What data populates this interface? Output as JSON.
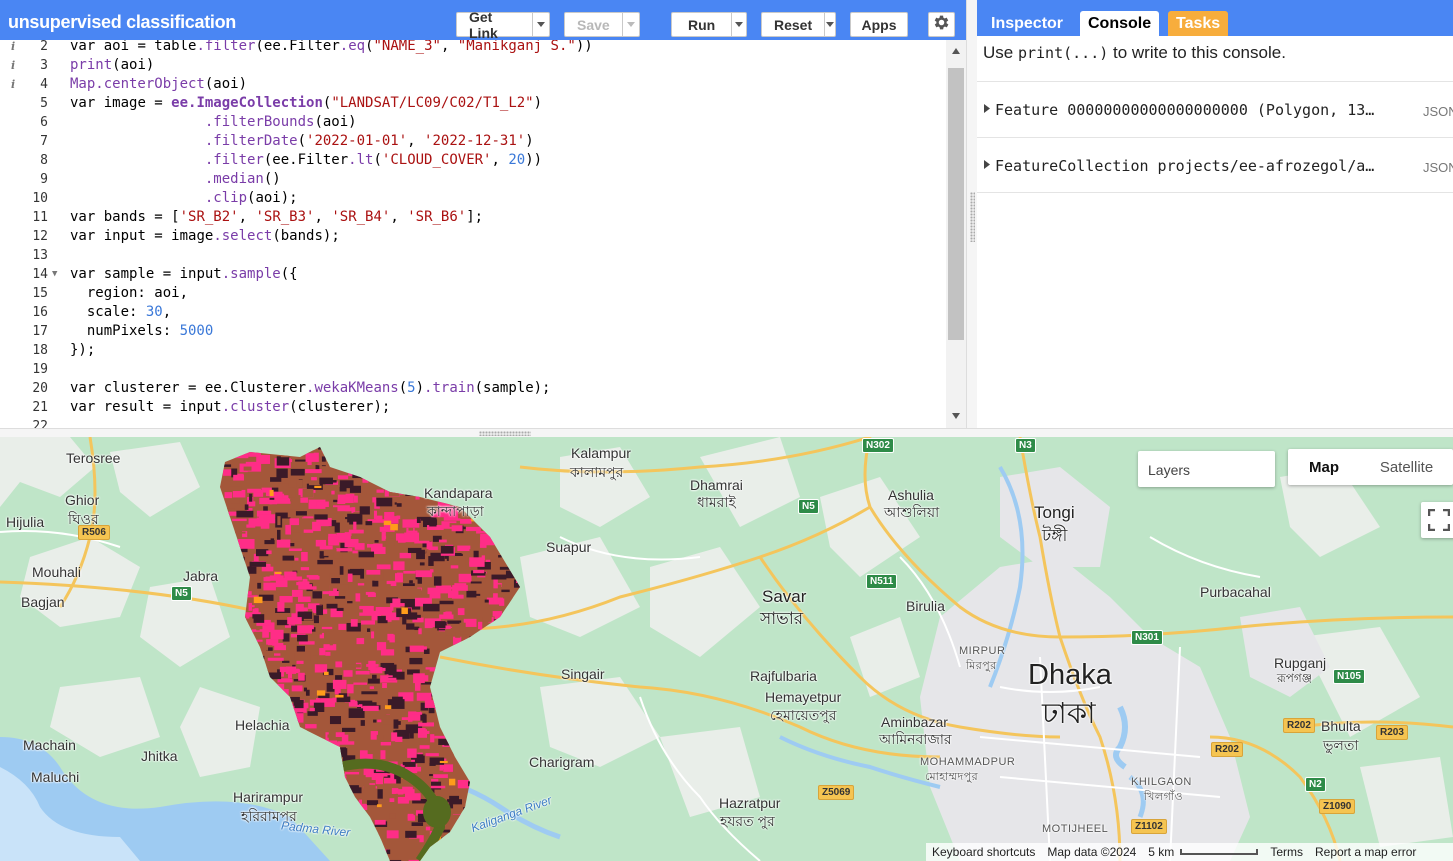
{
  "editor": {
    "script_title": "unsupervised classification",
    "buttons": {
      "get_link": "Get Link",
      "save": "Save",
      "run": "Run",
      "reset": "Reset",
      "apps": "Apps"
    },
    "lines": [
      {
        "num": "2",
        "info": true,
        "html": "var aoi = table.filter(ee.Filter.eq(\"NAME_3\", \"Manikganj S.\"))"
      },
      {
        "num": "3",
        "info": true,
        "html": "print(aoi)"
      },
      {
        "num": "4",
        "info": true,
        "html": "Map.centerObject(aoi)"
      },
      {
        "num": "5",
        "info": false,
        "html": "var image = ee.ImageCollection(\"LANDSAT/LC09/C02/T1_L2\")"
      },
      {
        "num": "6",
        "info": false,
        "html": "                .filterBounds(aoi)"
      },
      {
        "num": "7",
        "info": false,
        "html": "                .filterDate('2022-01-01', '2022-12-31')"
      },
      {
        "num": "8",
        "info": false,
        "html": "                .filter(ee.Filter.lt('CLOUD_COVER', 20))"
      },
      {
        "num": "9",
        "info": false,
        "html": "                .median()"
      },
      {
        "num": "10",
        "info": false,
        "html": "                .clip(aoi);"
      },
      {
        "num": "11",
        "info": false,
        "html": "var bands = ['SR_B2', 'SR_B3', 'SR_B4', 'SR_B6'];"
      },
      {
        "num": "12",
        "info": false,
        "html": "var input = image.select(bands);"
      },
      {
        "num": "13",
        "info": false,
        "html": ""
      },
      {
        "num": "14",
        "info": false,
        "fold": true,
        "html": "var sample = input.sample({"
      },
      {
        "num": "15",
        "info": false,
        "html": "  region: aoi,"
      },
      {
        "num": "16",
        "info": false,
        "html": "  scale: 30,"
      },
      {
        "num": "17",
        "info": false,
        "html": "  numPixels: 5000"
      },
      {
        "num": "18",
        "info": false,
        "html": "});"
      },
      {
        "num": "19",
        "info": false,
        "html": ""
      },
      {
        "num": "20",
        "info": false,
        "html": "var clusterer = ee.Clusterer.wekaKMeans(5).train(sample);"
      },
      {
        "num": "21",
        "info": false,
        "html": "var result = input.cluster(clusterer);"
      },
      {
        "num": "22",
        "info": false,
        "html": ""
      }
    ]
  },
  "right_panel": {
    "tabs": {
      "inspector": "Inspector",
      "console": "Console",
      "tasks": "Tasks"
    },
    "hint_pre": "Use ",
    "hint_code": "print(...)",
    "hint_post": " to write to this console.",
    "rows": [
      {
        "text": "Feature 00000000000000000000 (Polygon, 13…",
        "json": "JSON"
      },
      {
        "text": "FeatureCollection projects/ee-afrozegol/a…",
        "json": "JSON"
      }
    ]
  },
  "map": {
    "layers_label": "Layers",
    "map_type": {
      "map": "Map",
      "satellite": "Satellite"
    },
    "footer": {
      "shortcuts": "Keyboard shortcuts",
      "map_data": "Map data ©2024",
      "scale": "5 km",
      "terms": "Terms",
      "report": "Report a map error"
    },
    "places": {
      "terosree": "Terosree",
      "ghior": "Ghior",
      "ghior_bn": "ঘিওর",
      "hijulia": "Hijulia",
      "mouhali": "Mouhali",
      "bagjan": "Bagjan",
      "jabra": "Jabra",
      "kalampur": "Kalampur",
      "kalampur_bn": "কালামপুর",
      "kandapara": "Kandapara",
      "kandapara_bn": "কান্দাপাড়া",
      "dhamrai": "Dhamrai",
      "dhamrai_bn": "ধামরাই",
      "ashulia": "Ashulia",
      "ashulia_bn": "আশুলিয়া",
      "tongi": "Tongi",
      "tongi_bn": "টঙ্গী",
      "suapur": "Suapur",
      "savar": "Savar",
      "savar_bn": "সাভার",
      "birulia": "Birulia",
      "purbacahal": "Purbacahal",
      "mirpur": "MIRPUR",
      "mirpur_bn": "মিরপুর",
      "dhaka": "Dhaka",
      "dhaka_bn": "ঢাকা",
      "rupganj": "Rupganj",
      "rupganj_bn": "রূপগঞ্জ",
      "singair": "Singair",
      "rajfulbaria": "Rajfulbaria",
      "hemayetpur": "Hemayetpur",
      "hemayetpur_bn": "হেমায়েতপুর",
      "aminbazar": "Aminbazar",
      "aminbazar_bn": "আমিনবাজার",
      "bhulta": "Bhulta",
      "bhulta_bn": "ভুলতা",
      "helachia": "Helachia",
      "machain": "Machain",
      "jhitka": "Jhitka",
      "maluchi": "Maluchi",
      "charigram": "Charigram",
      "mohammadpur": "MOHAMMADPUR",
      "mohammadpur_bn": "মোহাম্মদপুর",
      "khilgaon": "KHILGAON",
      "khilgaon_bn": "খিলগাঁও",
      "harirampur": "Harirampur",
      "harirampur_bn": "হরিরামপুর",
      "padma": "Padma River",
      "kaliganga": "Kaliganga River",
      "hazratpur": "Hazratpur",
      "hazratpur_bn": "হযরত পুর",
      "motijheel": "MOTIJHEEL"
    },
    "roads": {
      "n302": "N302",
      "n3": "N3",
      "n5a": "N5",
      "r506": "R506",
      "n5b": "N5",
      "n511": "N511",
      "n301": "N301",
      "n105": "N105",
      "r202a": "R202",
      "r202b": "R202",
      "r203": "R203",
      "n2": "N2",
      "z5069": "Z5069",
      "z1090": "Z1090",
      "z1102": "Z1102"
    },
    "colors": {
      "class_pink": "#ff2d87",
      "class_brown": "#a4573a",
      "class_dark": "#3a1a28",
      "class_olive": "#556b1f",
      "class_orange": "#ff9c1a"
    }
  }
}
